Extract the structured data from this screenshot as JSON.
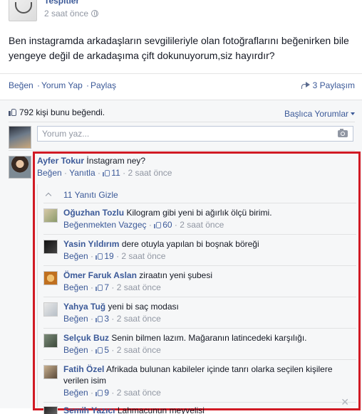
{
  "post": {
    "page_name": "Tespitler",
    "time": "2 saat önce",
    "text": "Ben instagramda arkadaşların sevgilileriyle olan fotoğraflarını beğenirken bile yengeye değil de arkadaşıma çift dokunuyorum,siz hayırdır?"
  },
  "actions": {
    "like": "Beğen",
    "comment": "Yorum Yap",
    "share": "Paylaş",
    "share_count": "3 Paylaşım"
  },
  "feedback": {
    "likes_text": "792 kişi bunu beğendi.",
    "sort_label": "Başlıca Yorumlar",
    "composer_placeholder": "Yorum yaz..."
  },
  "main_comment": {
    "author": "Ayfer Tokur",
    "text": "İnstagram ney?",
    "like": "Beğen",
    "reply": "Yanıtla",
    "likes": "11",
    "time": "2 saat önce"
  },
  "replies": {
    "hide_label": "11 Yanıtı Gizle",
    "items": [
      {
        "author": "Oğuzhan Tozlu",
        "text": "Kilogram gibi yeni bi ağırlık ölçü birimi.",
        "like": "Beğenmekten Vazgeç",
        "likes": "60",
        "time": "2 saat önce"
      },
      {
        "author": "Yasin Yıldırım",
        "text": "dere otuyla yapılan bi boşnak böreği",
        "like": "Beğen",
        "likes": "19",
        "time": "2 saat önce"
      },
      {
        "author": "Ömer Faruk Aslan",
        "text": "ziraatın yeni şubesi",
        "like": "Beğen",
        "likes": "7",
        "time": "2 saat önce"
      },
      {
        "author": "Yahya Tuğ",
        "text": "yeni bi saç modası",
        "like": "Beğen",
        "likes": "3",
        "time": "2 saat önce"
      },
      {
        "author": "Selçuk Buz",
        "text": "Senin bilmen lazım. Mağaranın latincedeki karşılığı.",
        "like": "Beğen",
        "likes": "5",
        "time": "2 saat önce"
      },
      {
        "author": "Fatih Özel",
        "text": "Afrikada bulunan kabileler içinde tanrı olarka seçilen kişilere verilen isim",
        "like": "Beğen",
        "likes": "9",
        "time": "2 saat önce"
      },
      {
        "author": "Semih Yazıcı",
        "text": "Lahmacunun meyvelisi",
        "like": "",
        "likes": "",
        "time": ""
      }
    ]
  },
  "colors": {
    "link": "#3b5998",
    "highlight": "#d11a24",
    "muted": "#9197a3"
  }
}
